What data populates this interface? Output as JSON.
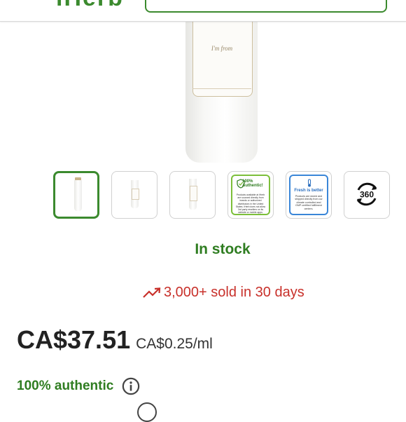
{
  "header": {
    "logo_fragment": "iHerb"
  },
  "hero": {
    "bottle_text": "I'm from"
  },
  "thumbnails": [
    {
      "name": "thumb-front"
    },
    {
      "name": "thumb-side"
    },
    {
      "name": "thumb-back"
    },
    {
      "name": "thumb-authentic",
      "title": "100% Authentic!",
      "body": "Products available at iHerb are sourced directly from brands or authorized distributors in the United States. iHerb does not allow 3rd party resellers on its website or mobile apps."
    },
    {
      "name": "thumb-fresh",
      "title": "Fresh is better",
      "body": "Products are stored and shipped directly from our climate controlled and GMP certified fulfillment centers."
    },
    {
      "name": "thumb-360",
      "label": "360"
    }
  ],
  "stock_status": "In stock",
  "sold_text": "3,000+ sold in 30 days",
  "price": "CA$37.51",
  "unit_price": "CA$0.25/ml",
  "authentic_label": "100% authentic",
  "colors": {
    "accent": "#3b8a2e",
    "sold": "#c8302a"
  }
}
